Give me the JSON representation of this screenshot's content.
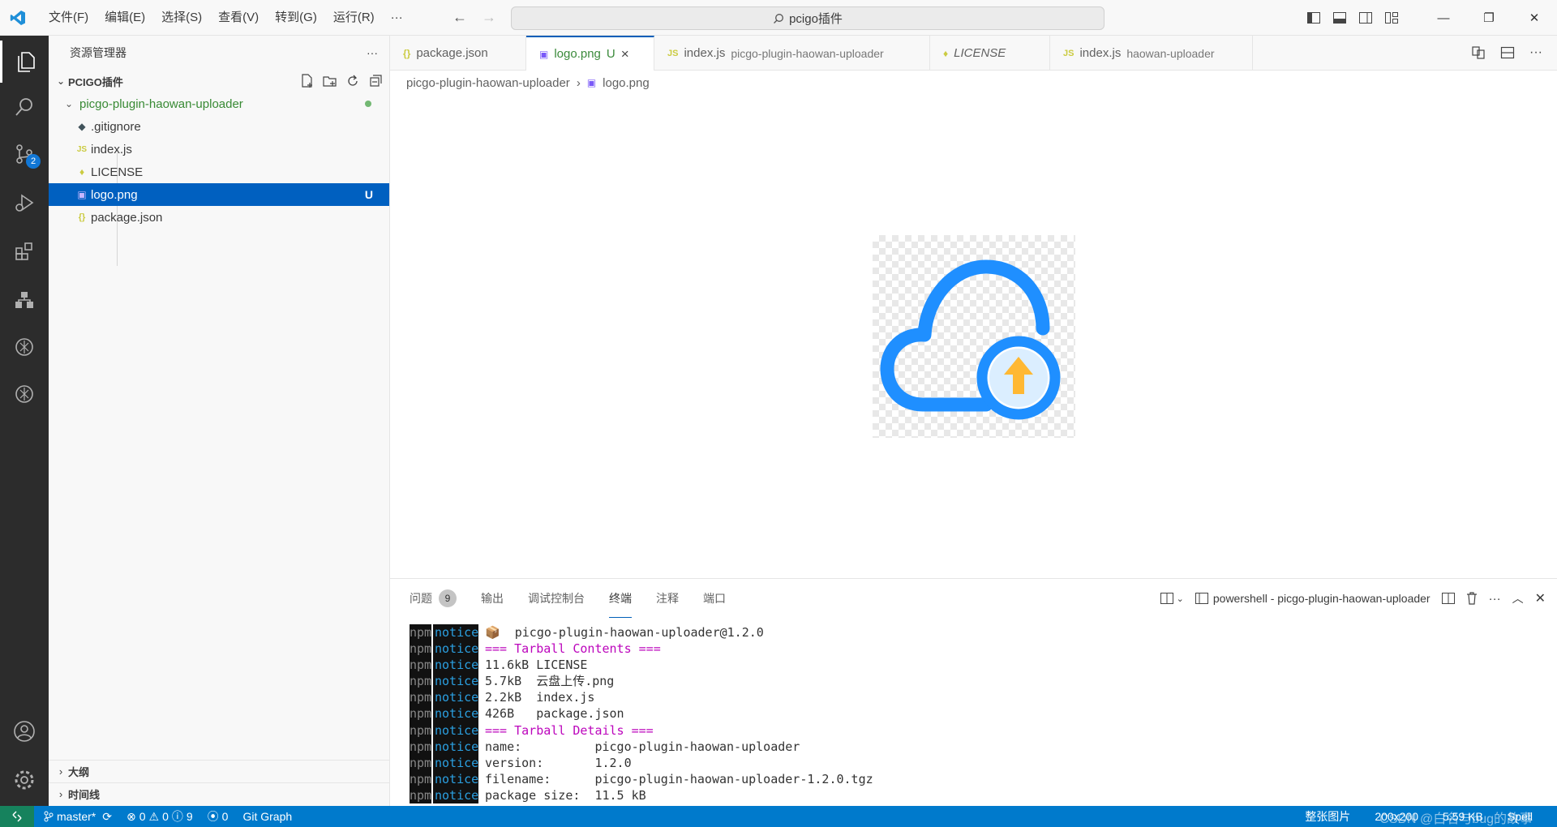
{
  "titlebar": {
    "menu": [
      "文件(F)",
      "编辑(E)",
      "选择(S)",
      "查看(V)",
      "转到(G)",
      "运行(R)",
      "···"
    ],
    "search": "pcigo插件"
  },
  "activity": {
    "scm_badge": "2"
  },
  "sidebar": {
    "header": "资源管理器",
    "more": "···",
    "workspace": "PCIGO插件",
    "folder": "picgo-plugin-haowan-uploader",
    "files": [
      {
        "icon": "◆",
        "name": ".gitignore"
      },
      {
        "icon": "JS",
        "name": "index.js"
      },
      {
        "icon": "♦",
        "name": "LICENSE"
      },
      {
        "icon": "▣",
        "name": "logo.png",
        "status": "U"
      },
      {
        "icon": "{}",
        "name": "package.json"
      }
    ],
    "outline": "大纲",
    "timeline": "时间线"
  },
  "tabs": [
    {
      "icon": "{}",
      "name": "package.json",
      "desc": ""
    },
    {
      "icon": "▣",
      "name": "logo.png",
      "status": "U",
      "close": "×"
    },
    {
      "icon": "JS",
      "name": "index.js",
      "desc": "picgo-plugin-haowan-uploader"
    },
    {
      "icon": "♦",
      "name": "LICENSE",
      "desc": ""
    },
    {
      "icon": "JS",
      "name": "index.js",
      "desc": "haowan-uploader"
    }
  ],
  "breadcrumb": {
    "folder": "picgo-plugin-haowan-uploader",
    "sep": "›",
    "file": "logo.png"
  },
  "panel": {
    "tabs": [
      "问题",
      "输出",
      "调试控制台",
      "终端",
      "注释",
      "端口"
    ],
    "problems_count": "9",
    "terminal_name": "powershell - picgo-plugin-haowan-uploader",
    "lines": [
      {
        "text": "📦  picgo-plugin-haowan-uploader@1.2.0",
        "style": ""
      },
      {
        "text": "=== Tarball Contents ===",
        "style": "mag"
      },
      {
        "text": "11.6kB LICENSE",
        "style": ""
      },
      {
        "text": "5.7kB  云盘上传.png",
        "style": ""
      },
      {
        "text": "2.2kB  index.js",
        "style": ""
      },
      {
        "text": "426B   package.json",
        "style": ""
      },
      {
        "text": "=== Tarball Details ===",
        "style": "mag"
      },
      {
        "text": "name:          picgo-plugin-haowan-uploader",
        "style": ""
      },
      {
        "text": "version:       1.2.0",
        "style": ""
      },
      {
        "text": "filename:      picgo-plugin-haowan-uploader-1.2.0.tgz",
        "style": ""
      },
      {
        "text": "package size:  11.5 kB",
        "style": ""
      }
    ],
    "npm_label": "npm",
    "notice_label": "notice"
  },
  "status": {
    "branch": "master*",
    "errors": "0",
    "warnings": "0",
    "infos": "9",
    "ports": "0",
    "git_graph": "Git Graph",
    "right": [
      "整张图片",
      "200x200",
      "5.59 KB",
      "Spell"
    ],
    "watermark": "CSDN @白名与bug的故事"
  },
  "colors": {
    "accent": "#005fb8",
    "statusbar": "#007acc",
    "cloud": "#1f8fff",
    "arrow": "#ffb833"
  }
}
